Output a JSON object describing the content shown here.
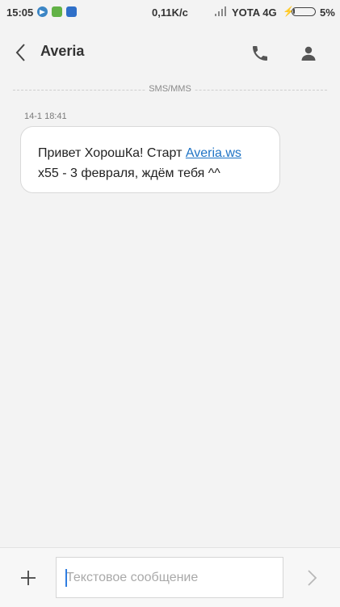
{
  "status_bar": {
    "time": "15:05",
    "speed": "0,11K/c",
    "carrier": "YOTA 4G",
    "battery": "5%",
    "icons": [
      "telegram-icon",
      "green-app-icon",
      "blue-app-icon",
      "signal-icon",
      "charging-icon",
      "battery-icon"
    ]
  },
  "header": {
    "title": "Averia",
    "icons": [
      "back-arrow-icon",
      "phone-icon",
      "contact-icon"
    ]
  },
  "thread": {
    "separator_label": "SMS/MMS",
    "messages": [
      {
        "timestamp": "14-1 18:41",
        "text_before": "Привет ХорошКа! Старт ",
        "link": "Averia.ws",
        "text_after": "x55 -  3 февраля, ждём тебя ^^"
      }
    ]
  },
  "composer": {
    "placeholder": "Текстовое сообщение",
    "value": "",
    "icons": [
      "plus-icon",
      "send-icon"
    ]
  },
  "colors": {
    "background": "#f3f3f3",
    "bubble": "#ffffff",
    "link": "#1e73c5",
    "caret": "#2f7de0"
  }
}
